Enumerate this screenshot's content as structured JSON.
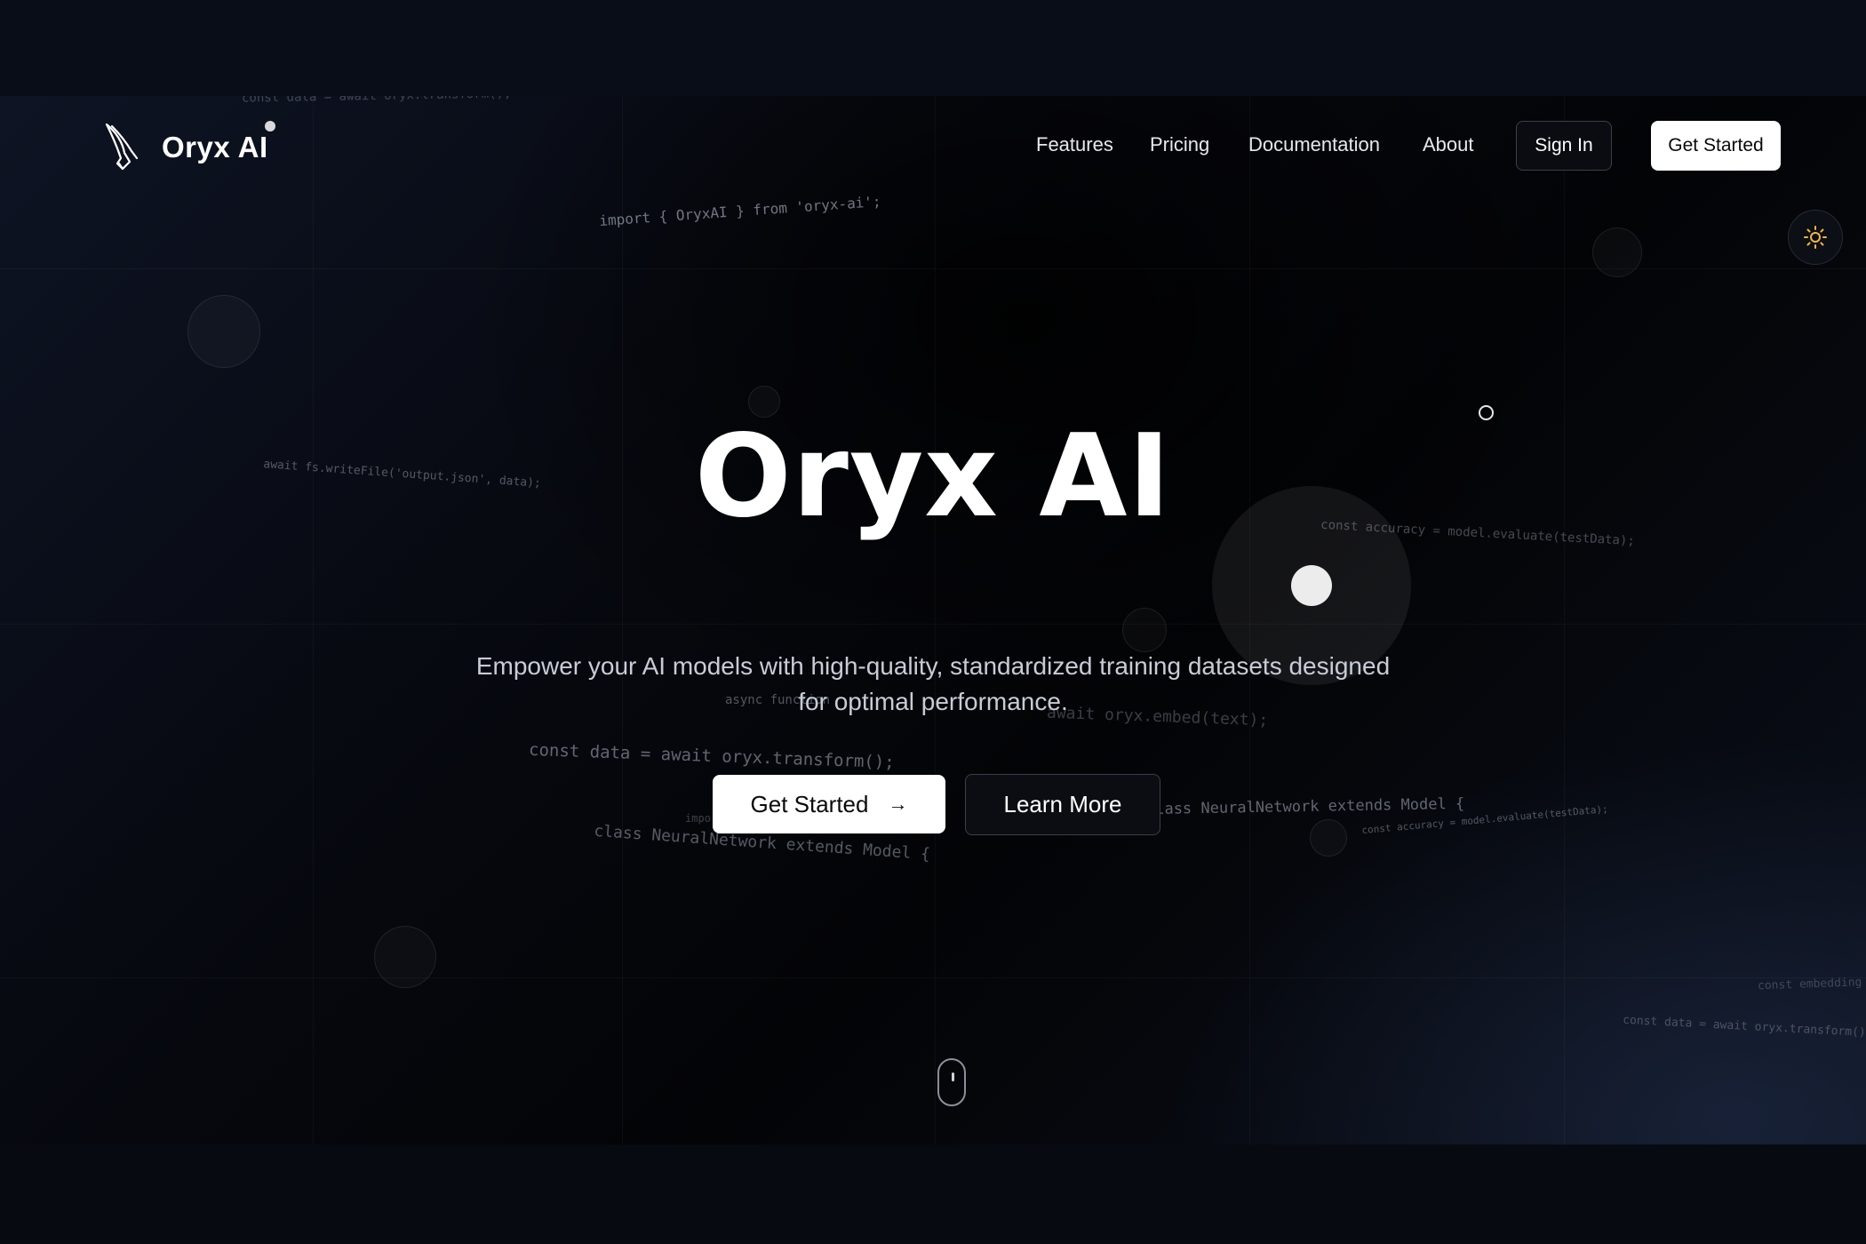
{
  "brand": {
    "name": "Oryx AI",
    "logo_icon": "oryx-horn-icon"
  },
  "nav": {
    "links": [
      "Features",
      "Pricing",
      "Documentation",
      "About"
    ],
    "sign_in": "Sign In",
    "get_started": "Get Started"
  },
  "theme_toggle": {
    "icon": "sun-icon",
    "color": "#f5b642"
  },
  "hero": {
    "title": "Oryx AI",
    "subtitle": "Empower your AI models with high-quality, standardized training datasets designed for optimal performance.",
    "primary_button": "Get Started",
    "primary_icon": "arrow-right-icon",
    "secondary_button": "Learn More"
  },
  "background_code": [
    "const data = await oryx.transform();",
    "import { OryxAI } from 'oryx-ai';",
    "await fs.writeFile('output.json', data);",
    "const accuracy = model.evaluate(testData);",
    "async function",
    "await oryx.embed(text);",
    "const data = await oryx.transform();",
    "class NeuralNetwork extends Model {",
    "class NeuralNetwork extends Model {",
    "const accuracy = model.evaluate(testData);",
    "const embedding =",
    "const data = await oryx.transform();",
    "impo"
  ],
  "scroll_indicator": {
    "icon": "mouse-scroll-icon"
  },
  "colors": {
    "background": "#05070c",
    "button_primary_bg": "#ffffff",
    "button_primary_text": "#0a0a0a",
    "border": "#3a3f4a"
  }
}
